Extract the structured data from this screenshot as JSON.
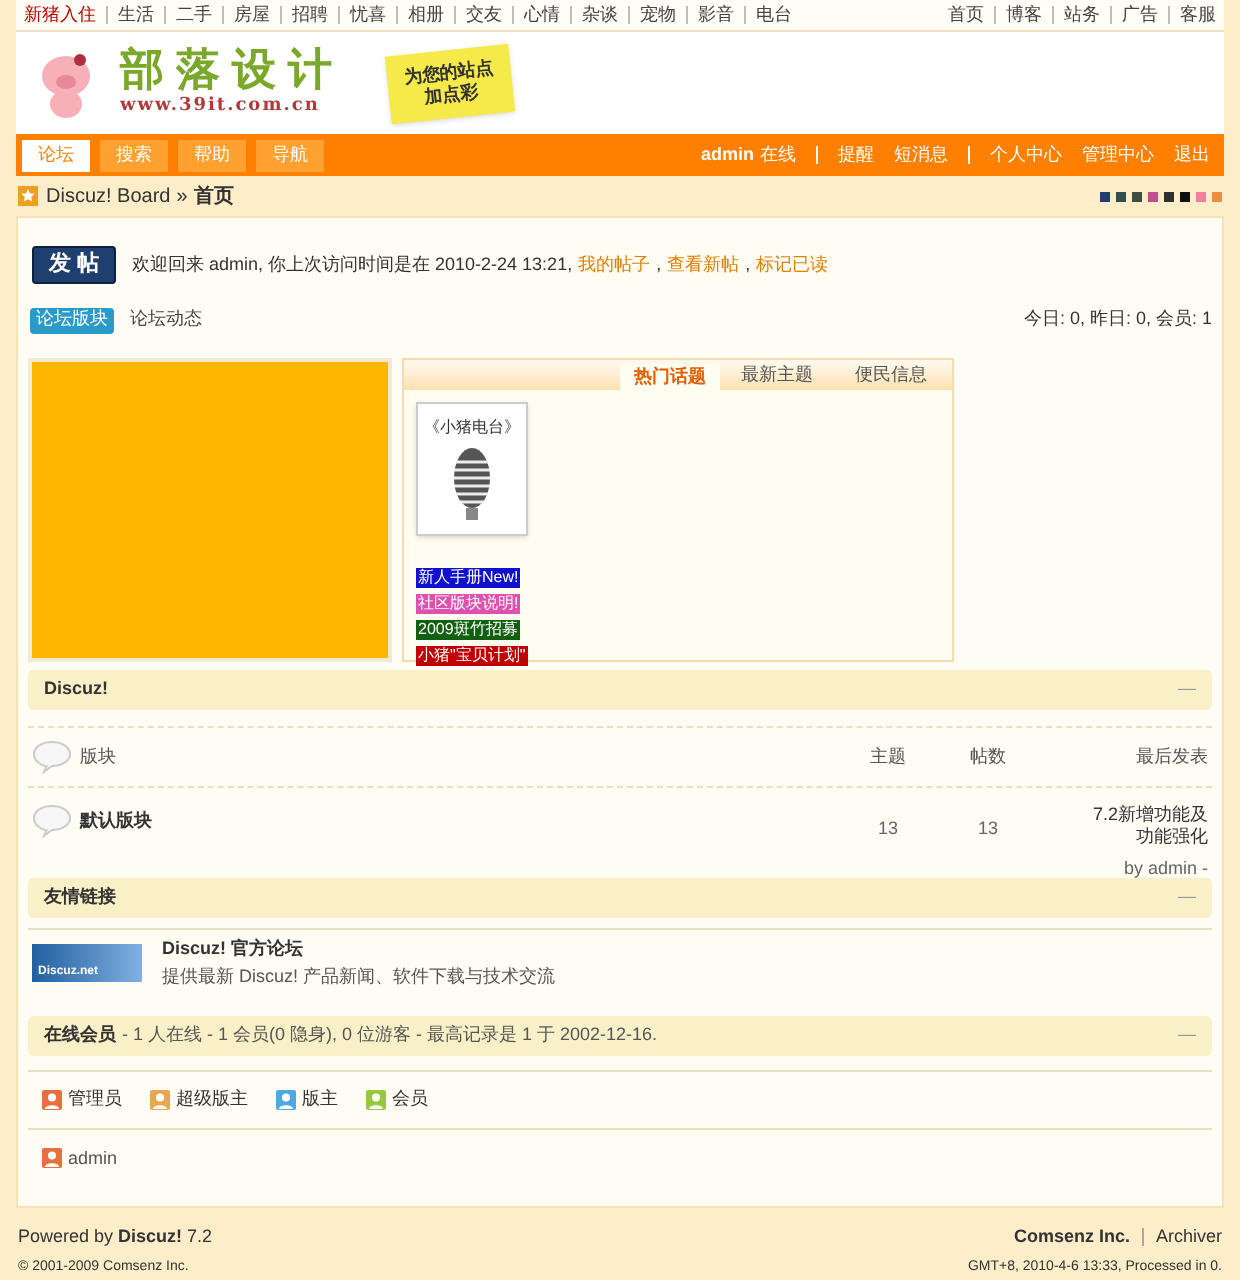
{
  "top_links": {
    "left": [
      {
        "label": "新猪入住",
        "highlight": true
      },
      {
        "label": "生活",
        "highlight": false
      },
      {
        "label": "二手",
        "highlight": false
      },
      {
        "label": "房屋",
        "highlight": false
      },
      {
        "label": "招聘",
        "highlight": false
      },
      {
        "label": "忧喜",
        "highlight": false
      },
      {
        "label": "相册",
        "highlight": false
      },
      {
        "label": "交友",
        "highlight": false
      },
      {
        "label": "心情",
        "highlight": false
      },
      {
        "label": "杂谈",
        "highlight": false
      },
      {
        "label": "宠物",
        "highlight": false
      },
      {
        "label": "影音",
        "highlight": false
      },
      {
        "label": "电台",
        "highlight": false
      }
    ],
    "right": [
      "首页",
      "博客",
      "站务",
      "广告",
      "客服"
    ]
  },
  "logo": {
    "title": "部落设计",
    "url": "www.39it.com.cn",
    "note": [
      "为您的站点",
      "加点彩"
    ]
  },
  "nav": {
    "tabs": [
      {
        "label": "论坛",
        "selected": true
      },
      {
        "label": "搜索",
        "selected": false
      },
      {
        "label": "帮助",
        "selected": false
      },
      {
        "label": "导航",
        "selected": false
      }
    ],
    "user": "admin",
    "user_status": "在线",
    "links": [
      "提醒",
      "短消息"
    ],
    "links2": [
      "个人中心",
      "管理中心",
      "退出"
    ]
  },
  "breadcrumb": {
    "root": "Discuz! Board",
    "sep": "»",
    "current": "首页"
  },
  "style_swatches": [
    {
      "color": "#1f3f6f"
    },
    {
      "color": "#2f4f4f"
    },
    {
      "color": "#3f4f3f"
    },
    {
      "color": "#c04f8f"
    },
    {
      "color": "#2f2f2f"
    },
    {
      "color": "#101010"
    },
    {
      "color": "#f07fa0"
    },
    {
      "color": "#e8903f"
    }
  ],
  "welcome": {
    "post_button": "发 帖",
    "text": "欢迎回来  admin, 你上次访问时间是在  2010-2-24 13:21,",
    "links": [
      "我的帖子",
      "查看新帖",
      "标记已读"
    ],
    "link_separator": ","
  },
  "view_tabs": [
    {
      "label": "论坛版块",
      "selected": true
    },
    {
      "label": "论坛动态",
      "selected": false
    }
  ],
  "stats": "今日: 0, 昨日: 0, 会员: 1",
  "hot_box": {
    "tabs": [
      {
        "label": "热门话题",
        "selected": true
      },
      {
        "label": "最新主题",
        "selected": false
      },
      {
        "label": "便民信息",
        "selected": false
      }
    ],
    "card_caption": "《小猪电台》",
    "tags": [
      {
        "label": "新人手册New!",
        "color": "#1010d0"
      },
      {
        "label": "社区版块说明!",
        "color": "#e050b0"
      },
      {
        "label": "2009斑竹招募",
        "color": "#106010"
      },
      {
        "label": "小猪\"宝贝计划\"",
        "color": "#c00000"
      }
    ]
  },
  "category": {
    "title": "Discuz!",
    "collapse": "—",
    "columns": [
      "版块",
      "主题",
      "帖数",
      "最后发表"
    ],
    "forums": [
      {
        "name": "默认版块",
        "topics": "13",
        "posts": "13",
        "last_title": "7.2新增功能及功能强化",
        "last_by": "by admin -"
      }
    ]
  },
  "links_section": {
    "title": "友情链接",
    "collapse": "—",
    "items": [
      {
        "logo_text": "Discuz.net",
        "name": "Discuz! 官方论坛",
        "desc": "提供最新  Discuz! 产品新闻、软件下载与技术交流"
      }
    ]
  },
  "online": {
    "title": "在线会员",
    "summary": "- 1 人在线  - 1 会员(0 隐身), 0 位游客  - 最高记录是  1 于  2002-12-16.",
    "collapse": "—",
    "legend": [
      {
        "label": "管理员",
        "color": "#e8703f"
      },
      {
        "label": "超级版主",
        "color": "#e8a850"
      },
      {
        "label": "版主",
        "color": "#50a8e0"
      },
      {
        "label": "会员",
        "color": "#98c840"
      }
    ],
    "users": [
      {
        "name": "admin",
        "color": "#e8703f"
      }
    ]
  },
  "footer": {
    "powered": "Powered by **Discuz!** 7.2",
    "copyright": "© 2001-2009 Comsenz Inc.",
    "company": "Comsenz Inc.",
    "archiver": "Archiver",
    "time": "GMT+8, 2010-4-6 13:33, Processed in 0."
  }
}
